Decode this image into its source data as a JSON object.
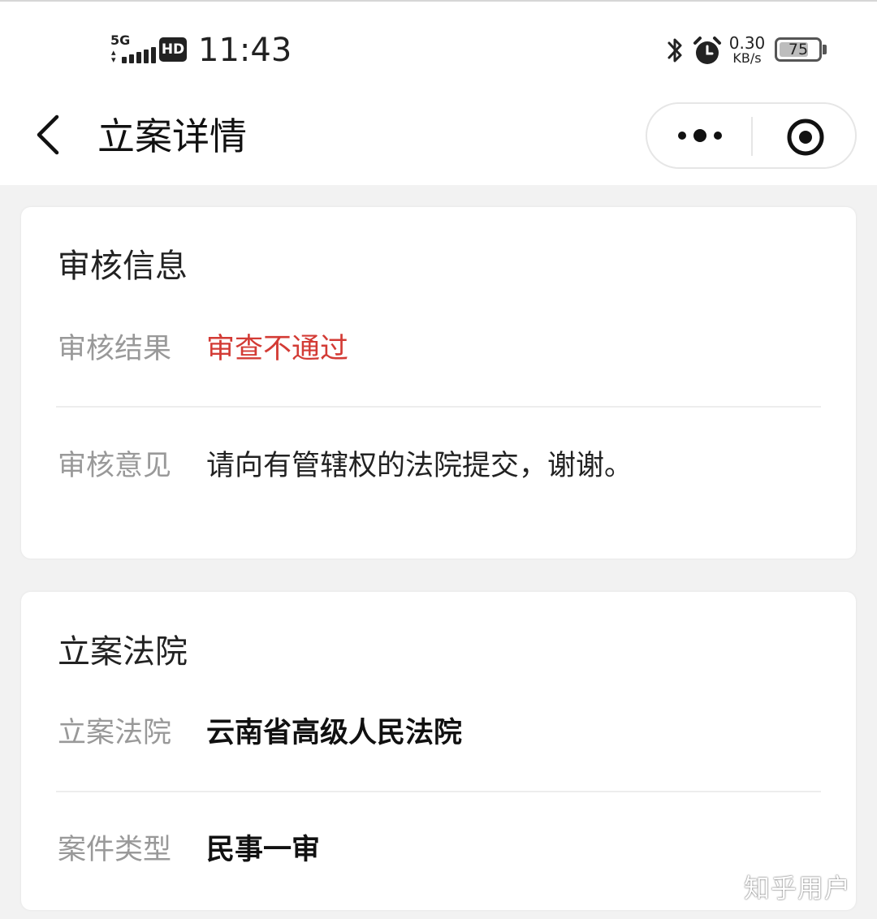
{
  "status_bar": {
    "network": "5G",
    "hd": "HD",
    "time": "11:43",
    "speed_value": "0.30",
    "speed_unit": "KB/s",
    "battery": "75",
    "battery_level": 0.75
  },
  "nav": {
    "title": "立案详情"
  },
  "review_card": {
    "title": "审核信息",
    "rows": [
      {
        "label": "审核结果",
        "value": "审查不通过"
      },
      {
        "label": "审核意见",
        "value": "请向有管辖权的法院提交，谢谢。"
      }
    ]
  },
  "court_card": {
    "title": "立案法院",
    "rows": [
      {
        "label": "立案法院",
        "value": "云南省高级人民法院"
      },
      {
        "label": "案件类型",
        "value": "民事一审"
      }
    ]
  },
  "watermark": "知乎用户",
  "colors": {
    "rejected_red": "#d33b35",
    "label_gray": "#999999",
    "page_bg": "#f2f2f2"
  }
}
